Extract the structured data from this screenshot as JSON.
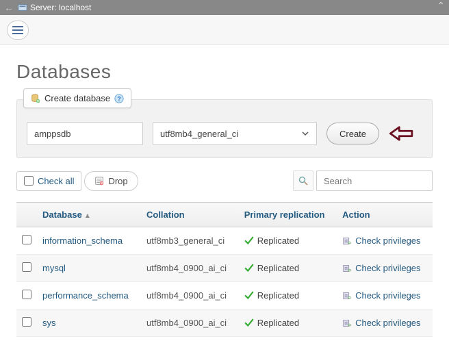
{
  "topbar": {
    "server_label": "Server: localhost"
  },
  "page": {
    "title": "Databases"
  },
  "create": {
    "tab_label": "Create database",
    "db_name": "amppsdb",
    "collation": "utf8mb4_general_ci",
    "button": "Create"
  },
  "actions": {
    "check_all": "Check all",
    "drop": "Drop",
    "search_placeholder": "Search"
  },
  "columns": {
    "database": "Database",
    "collation": "Collation",
    "replication": "Primary replication",
    "action": "Action"
  },
  "rows": [
    {
      "name": "information_schema",
      "collation": "utf8mb3_general_ci",
      "replicated": "Replicated",
      "priv": "Check privileges"
    },
    {
      "name": "mysql",
      "collation": "utf8mb4_0900_ai_ci",
      "replicated": "Replicated",
      "priv": "Check privileges"
    },
    {
      "name": "performance_schema",
      "collation": "utf8mb4_0900_ai_ci",
      "replicated": "Replicated",
      "priv": "Check privileges"
    },
    {
      "name": "sys",
      "collation": "utf8mb4_0900_ai_ci",
      "replicated": "Replicated",
      "priv": "Check privileges"
    }
  ]
}
